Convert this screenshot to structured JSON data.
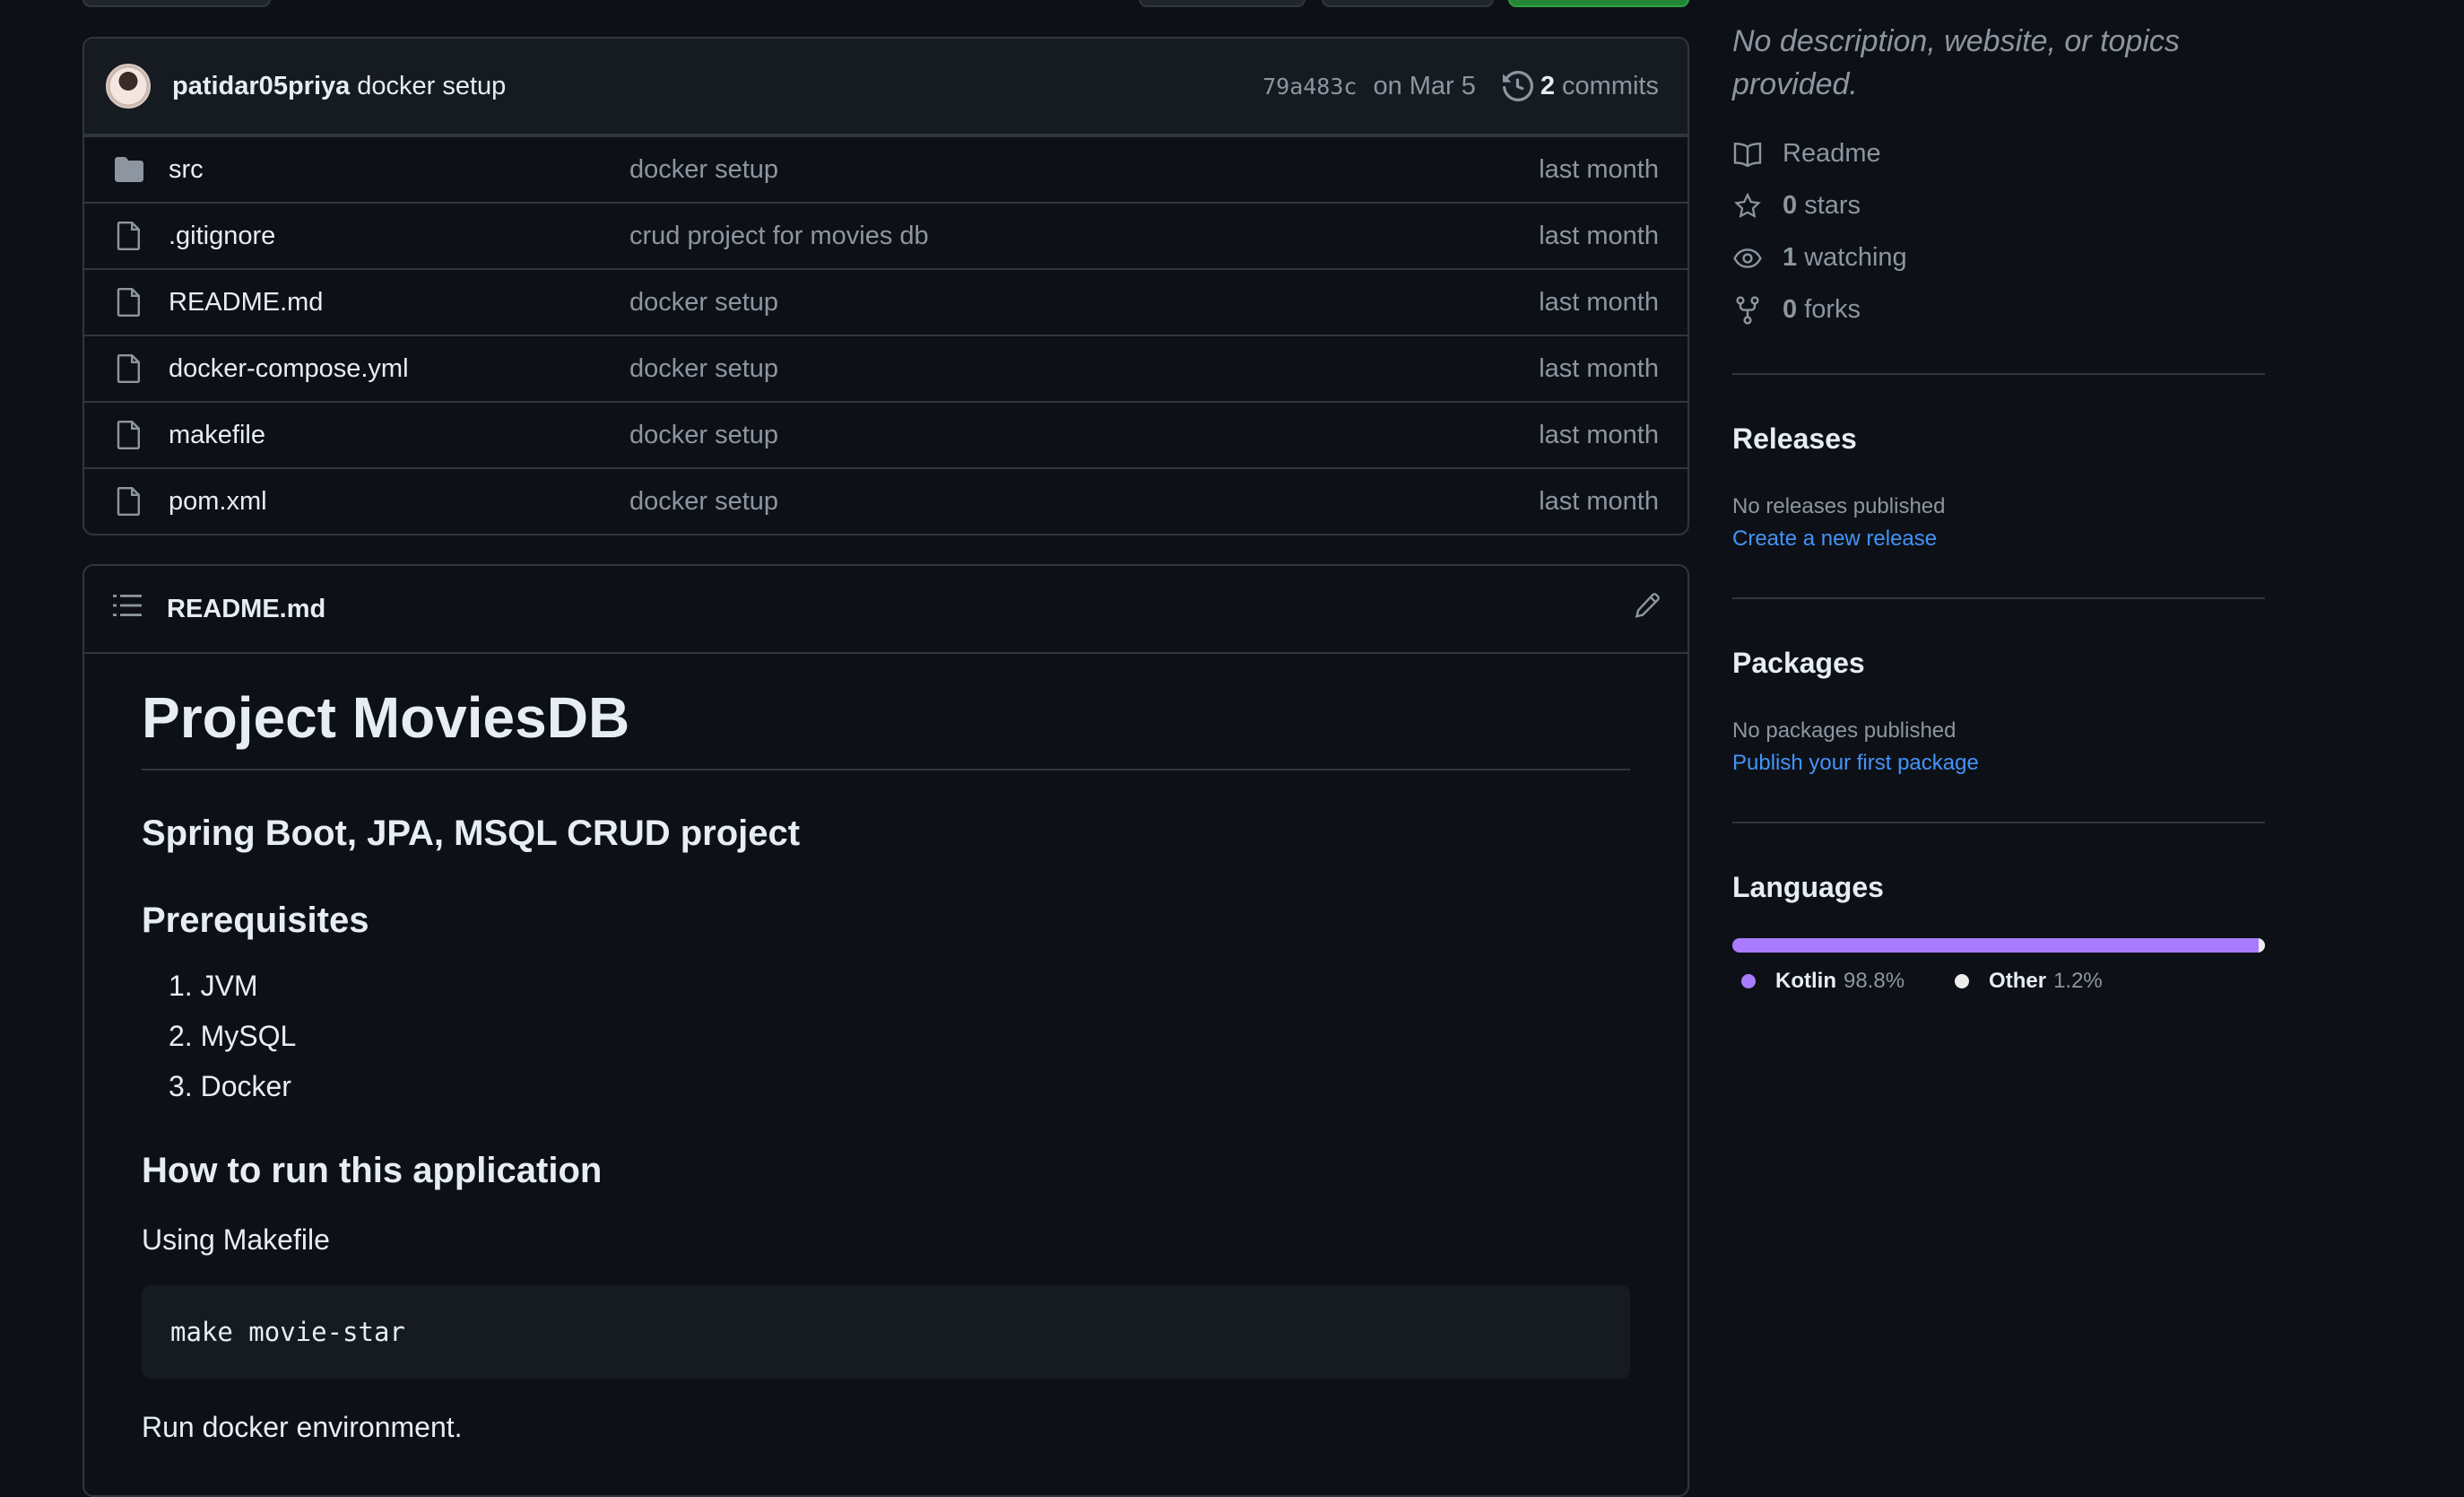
{
  "commit": {
    "author": "patidar05priya",
    "message": "docker setup",
    "sha": "79a483c",
    "date": "on Mar 5",
    "count": "2",
    "count_label": "commits"
  },
  "files": [
    {
      "name": "src",
      "type": "folder",
      "message": "docker setup",
      "age": "last month"
    },
    {
      "name": ".gitignore",
      "type": "file",
      "message": "crud project for movies db",
      "age": "last month"
    },
    {
      "name": "README.md",
      "type": "file",
      "message": "docker setup",
      "age": "last month"
    },
    {
      "name": "docker-compose.yml",
      "type": "file",
      "message": "docker setup",
      "age": "last month"
    },
    {
      "name": "makefile",
      "type": "file",
      "message": "docker setup",
      "age": "last month"
    },
    {
      "name": "pom.xml",
      "type": "file",
      "message": "docker setup",
      "age": "last month"
    }
  ],
  "readme": {
    "header_title": "README.md",
    "h1": "Project MoviesDB",
    "subtitle": "Spring Boot, JPA, MSQL CRUD project",
    "prereq_heading": "Prerequisites",
    "prereqs": [
      "1. JVM",
      "2. MySQL",
      "3. Docker"
    ],
    "run_heading": "How to run this application",
    "using_makefile": "Using Makefile",
    "code": "make movie-star",
    "run_docker": "Run docker environment."
  },
  "about": {
    "description": "No description, website, or topics provided.",
    "readme_label": "Readme",
    "stars_count": "0",
    "stars_label": "stars",
    "watching_count": "1",
    "watching_label": "watching",
    "forks_count": "0",
    "forks_label": "forks"
  },
  "releases": {
    "heading": "Releases",
    "status": "No releases published",
    "link": "Create a new release"
  },
  "packages": {
    "heading": "Packages",
    "status": "No packages published",
    "link": "Publish your first package"
  },
  "languages": {
    "heading": "Languages",
    "items": [
      {
        "name": "Kotlin",
        "percent": "98.8%",
        "value": 98.8,
        "color": "#A97BFF"
      },
      {
        "name": "Other",
        "percent": "1.2%",
        "value": 1.2,
        "color": "#EDEDED"
      }
    ]
  },
  "colors": {
    "background": "#0d1117",
    "border": "#30363d",
    "muted": "#8d96a0",
    "link": "#4493f8"
  }
}
